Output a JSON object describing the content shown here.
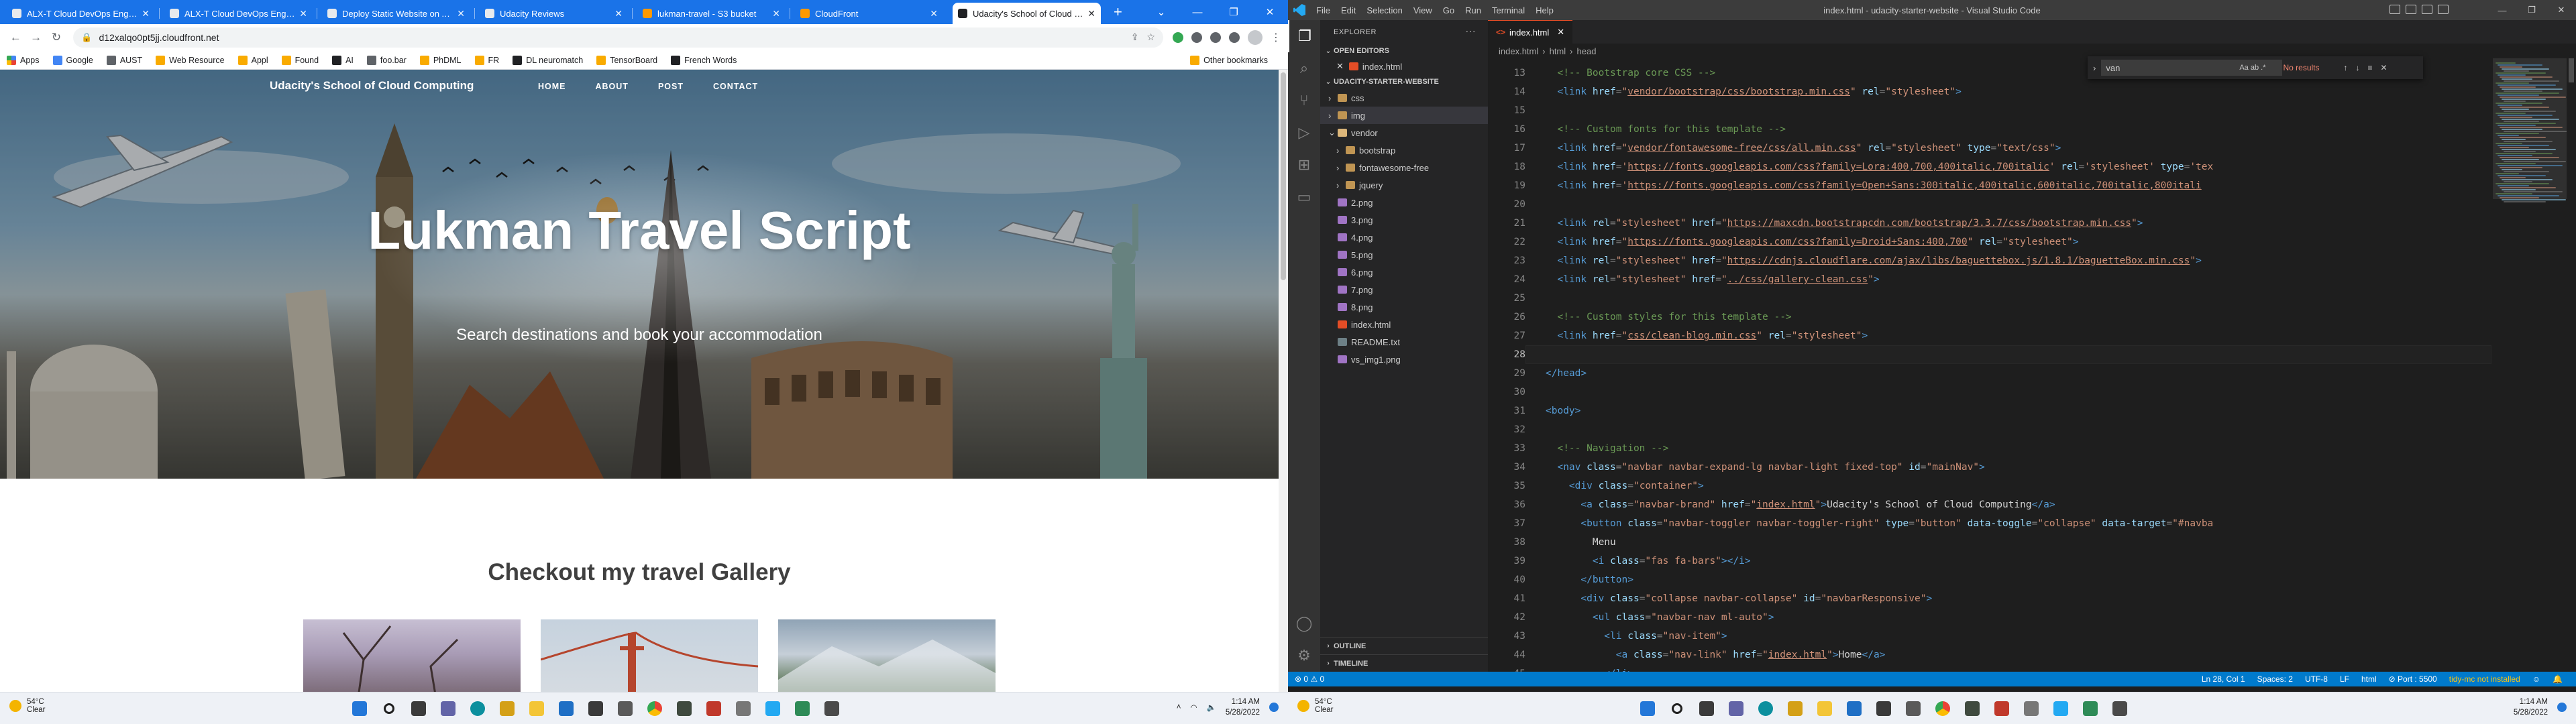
{
  "left": {
    "tabs": [
      {
        "title": "ALX-T Cloud DevOps Engineer",
        "color": "#e8eaed"
      },
      {
        "title": "ALX-T Cloud DevOps Engineer",
        "color": "#e8eaed"
      },
      {
        "title": "Deploy Static Website on AWS",
        "color": "#e8eaed"
      },
      {
        "title": "Udacity Reviews",
        "color": "#e8eaed"
      },
      {
        "title": "lukman-travel - S3 bucket",
        "color": "#ff9900"
      },
      {
        "title": "CloudFront",
        "color": "#ff9900"
      },
      {
        "title": "Udacity's School of Cloud Comp",
        "color": "#202124"
      }
    ],
    "address": "d12xalqo0pt5jj.cloudfront.net",
    "bookmarks": [
      "Apps",
      "Google",
      "AUST",
      "Web Resource",
      "Appl",
      "Found",
      "AI",
      "foo.bar",
      "PhDML",
      "FR",
      "DL neuromatch",
      "TensorBoard",
      "French Words"
    ],
    "other_bookmarks": "Other bookmarks",
    "site": {
      "brand": "Udacity's School of Cloud Computing",
      "nav": [
        "HOME",
        "ABOUT",
        "POST",
        "CONTACT"
      ],
      "hero_title": "Lukman Travel Script",
      "hero_subtitle": "Search destinations and book your accommodation",
      "gallery_heading": "Checkout my travel Gallery"
    },
    "taskbar": {
      "temp": "54°C",
      "weather": "Clear",
      "time": "1:14 AM",
      "date": "5/28/2022"
    }
  },
  "right": {
    "menu": [
      "File",
      "Edit",
      "Selection",
      "View",
      "Go",
      "Run",
      "Terminal",
      "Help"
    ],
    "window_title": "index.html - udacity-starter-website - Visual Studio Code",
    "explorer_title": "EXPLORER",
    "open_editors_label": "OPEN EDITORS",
    "open_editor_file": "index.html",
    "project_label": "UDACITY-STARTER-WEBSITE",
    "tree": [
      {
        "name": "css",
        "type": "folder",
        "depth": 1
      },
      {
        "name": "img",
        "type": "folder",
        "depth": 1,
        "selected": true
      },
      {
        "name": "vendor",
        "type": "folder-open",
        "depth": 1
      },
      {
        "name": "bootstrap",
        "type": "folder",
        "depth": 2
      },
      {
        "name": "fontawesome-free",
        "type": "folder",
        "depth": 2
      },
      {
        "name": "jquery",
        "type": "folder",
        "depth": 2
      },
      {
        "name": "2.png",
        "type": "img",
        "depth": 1
      },
      {
        "name": "3.png",
        "type": "img",
        "depth": 1
      },
      {
        "name": "4.png",
        "type": "img",
        "depth": 1
      },
      {
        "name": "5.png",
        "type": "img",
        "depth": 1
      },
      {
        "name": "6.png",
        "type": "img",
        "depth": 1
      },
      {
        "name": "7.png",
        "type": "img",
        "depth": 1
      },
      {
        "name": "8.png",
        "type": "img",
        "depth": 1
      },
      {
        "name": "index.html",
        "type": "html",
        "depth": 1
      },
      {
        "name": "README.txt",
        "type": "txt",
        "depth": 1
      },
      {
        "name": "vs_img1.png",
        "type": "img",
        "depth": 1
      }
    ],
    "outline_label": "OUTLINE",
    "timeline_label": "TIMELINE",
    "editor_tab": "index.html",
    "breadcrumb": [
      "index.html",
      "html",
      "head"
    ],
    "find": {
      "query": "van",
      "result": "No results",
      "options": "Aa  ab  .*"
    },
    "code": [
      {
        "n": 13,
        "parts": [
          [
            "com",
            "  <!-- Bootstrap core CSS -->"
          ]
        ]
      },
      {
        "n": 14,
        "parts": [
          [
            "tag",
            "  <link "
          ],
          [
            "att",
            "href"
          ],
          [
            "pun",
            "="
          ],
          [
            "str",
            "\""
          ],
          [
            "url",
            "vendor/bootstrap/css/bootstrap.min.css"
          ],
          [
            "str",
            "\""
          ],
          [
            "att",
            " rel"
          ],
          [
            "pun",
            "="
          ],
          [
            "str",
            "\"stylesheet\""
          ],
          [
            "tag",
            ">"
          ]
        ]
      },
      {
        "n": 15,
        "parts": []
      },
      {
        "n": 16,
        "parts": [
          [
            "com",
            "  <!-- Custom fonts for this template -->"
          ]
        ]
      },
      {
        "n": 17,
        "parts": [
          [
            "tag",
            "  <link "
          ],
          [
            "att",
            "href"
          ],
          [
            "pun",
            "="
          ],
          [
            "str",
            "\""
          ],
          [
            "url",
            "vendor/fontawesome-free/css/all.min.css"
          ],
          [
            "str",
            "\""
          ],
          [
            "att",
            " rel"
          ],
          [
            "pun",
            "="
          ],
          [
            "str",
            "\"stylesheet\""
          ],
          [
            "att",
            " type"
          ],
          [
            "pun",
            "="
          ],
          [
            "str",
            "\"text/css\""
          ],
          [
            "tag",
            ">"
          ]
        ]
      },
      {
        "n": 18,
        "parts": [
          [
            "tag",
            "  <link "
          ],
          [
            "att",
            "href"
          ],
          [
            "pun",
            "="
          ],
          [
            "str",
            "'"
          ],
          [
            "url",
            "https://fonts.googleapis.com/css?family=Lora:400,700,400italic,700italic"
          ],
          [
            "str",
            "'"
          ],
          [
            "att",
            " rel"
          ],
          [
            "pun",
            "="
          ],
          [
            "str",
            "'stylesheet'"
          ],
          [
            "att",
            " type"
          ],
          [
            "pun",
            "="
          ],
          [
            "str",
            "'tex"
          ]
        ]
      },
      {
        "n": 19,
        "parts": [
          [
            "tag",
            "  <link "
          ],
          [
            "att",
            "href"
          ],
          [
            "pun",
            "="
          ],
          [
            "str",
            "'"
          ],
          [
            "url",
            "https://fonts.googleapis.com/css?family=Open+Sans:300italic,400italic,600italic,700italic,800itali"
          ]
        ]
      },
      {
        "n": 20,
        "parts": []
      },
      {
        "n": 21,
        "parts": [
          [
            "tag",
            "  <link "
          ],
          [
            "att",
            "rel"
          ],
          [
            "pun",
            "="
          ],
          [
            "str",
            "\"stylesheet\""
          ],
          [
            "att",
            " href"
          ],
          [
            "pun",
            "="
          ],
          [
            "str",
            "\""
          ],
          [
            "url",
            "https://maxcdn.bootstrapcdn.com/bootstrap/3.3.7/css/bootstrap.min.css"
          ],
          [
            "str",
            "\""
          ],
          [
            "tag",
            ">"
          ]
        ]
      },
      {
        "n": 22,
        "parts": [
          [
            "tag",
            "  <link "
          ],
          [
            "att",
            "href"
          ],
          [
            "pun",
            "="
          ],
          [
            "str",
            "\""
          ],
          [
            "url",
            "https://fonts.googleapis.com/css?family=Droid+Sans:400,700"
          ],
          [
            "str",
            "\""
          ],
          [
            "att",
            " rel"
          ],
          [
            "pun",
            "="
          ],
          [
            "str",
            "\"stylesheet\""
          ],
          [
            "tag",
            ">"
          ]
        ]
      },
      {
        "n": 23,
        "parts": [
          [
            "tag",
            "  <link "
          ],
          [
            "att",
            "rel"
          ],
          [
            "pun",
            "="
          ],
          [
            "str",
            "\"stylesheet\""
          ],
          [
            "att",
            " href"
          ],
          [
            "pun",
            "="
          ],
          [
            "str",
            "\""
          ],
          [
            "url",
            "https://cdnjs.cloudflare.com/ajax/libs/baguettebox.js/1.8.1/baguetteBox.min.css"
          ],
          [
            "str",
            "\""
          ],
          [
            "tag",
            ">"
          ]
        ]
      },
      {
        "n": 24,
        "parts": [
          [
            "tag",
            "  <link "
          ],
          [
            "att",
            "rel"
          ],
          [
            "pun",
            "="
          ],
          [
            "str",
            "\"stylesheet\""
          ],
          [
            "att",
            " href"
          ],
          [
            "pun",
            "="
          ],
          [
            "str",
            "\""
          ],
          [
            "url",
            "../css/gallery-clean.css"
          ],
          [
            "str",
            "\""
          ],
          [
            "tag",
            ">"
          ]
        ]
      },
      {
        "n": 25,
        "parts": []
      },
      {
        "n": 26,
        "parts": [
          [
            "com",
            "  <!-- Custom styles for this template -->"
          ]
        ]
      },
      {
        "n": 27,
        "parts": [
          [
            "tag",
            "  <link "
          ],
          [
            "att",
            "href"
          ],
          [
            "pun",
            "="
          ],
          [
            "str",
            "\""
          ],
          [
            "url",
            "css/clean-blog.min.css"
          ],
          [
            "str",
            "\""
          ],
          [
            "att",
            " rel"
          ],
          [
            "pun",
            "="
          ],
          [
            "str",
            "\"stylesheet\""
          ],
          [
            "tag",
            ">"
          ]
        ]
      },
      {
        "n": 28,
        "parts": [],
        "current": true
      },
      {
        "n": 29,
        "parts": [
          [
            "tag",
            "</head>"
          ]
        ]
      },
      {
        "n": 30,
        "parts": []
      },
      {
        "n": 31,
        "parts": [
          [
            "tag",
            "<body>"
          ]
        ]
      },
      {
        "n": 32,
        "parts": []
      },
      {
        "n": 33,
        "parts": [
          [
            "com",
            "  <!-- Navigation -->"
          ]
        ]
      },
      {
        "n": 34,
        "parts": [
          [
            "tag",
            "  <nav "
          ],
          [
            "att",
            "class"
          ],
          [
            "pun",
            "="
          ],
          [
            "str",
            "\"navbar navbar-expand-lg navbar-light fixed-top\""
          ],
          [
            "att",
            " id"
          ],
          [
            "pun",
            "="
          ],
          [
            "str",
            "\"mainNav\""
          ],
          [
            "tag",
            ">"
          ]
        ]
      },
      {
        "n": 35,
        "parts": [
          [
            "tag",
            "    <div "
          ],
          [
            "att",
            "class"
          ],
          [
            "pun",
            "="
          ],
          [
            "str",
            "\"container\""
          ],
          [
            "tag",
            ">"
          ]
        ]
      },
      {
        "n": 36,
        "parts": [
          [
            "tag",
            "      <a "
          ],
          [
            "att",
            "class"
          ],
          [
            "pun",
            "="
          ],
          [
            "str",
            "\"navbar-brand\""
          ],
          [
            "att",
            " href"
          ],
          [
            "pun",
            "="
          ],
          [
            "str",
            "\""
          ],
          [
            "url",
            "index.html"
          ],
          [
            "str",
            "\""
          ],
          [
            "tag",
            ">"
          ],
          [
            "txt",
            "Udacity's School of Cloud Computing"
          ],
          [
            "tag",
            "</a>"
          ]
        ]
      },
      {
        "n": 37,
        "parts": [
          [
            "tag",
            "      <button "
          ],
          [
            "att",
            "class"
          ],
          [
            "pun",
            "="
          ],
          [
            "str",
            "\"navbar-toggler navbar-toggler-right\""
          ],
          [
            "att",
            " type"
          ],
          [
            "pun",
            "="
          ],
          [
            "str",
            "\"button\""
          ],
          [
            "att",
            " data-toggle"
          ],
          [
            "pun",
            "="
          ],
          [
            "str",
            "\"collapse\""
          ],
          [
            "att",
            " data-target"
          ],
          [
            "pun",
            "="
          ],
          [
            "str",
            "\"#navba"
          ]
        ]
      },
      {
        "n": 38,
        "parts": [
          [
            "txt",
            "        Menu"
          ]
        ]
      },
      {
        "n": 39,
        "parts": [
          [
            "tag",
            "        <i "
          ],
          [
            "att",
            "class"
          ],
          [
            "pun",
            "="
          ],
          [
            "str",
            "\"fas fa-bars\""
          ],
          [
            "tag",
            "></i>"
          ]
        ]
      },
      {
        "n": 40,
        "parts": [
          [
            "tag",
            "      </button>"
          ]
        ]
      },
      {
        "n": 41,
        "parts": [
          [
            "tag",
            "      <div "
          ],
          [
            "att",
            "class"
          ],
          [
            "pun",
            "="
          ],
          [
            "str",
            "\"collapse navbar-collapse\""
          ],
          [
            "att",
            " id"
          ],
          [
            "pun",
            "="
          ],
          [
            "str",
            "\"navbarResponsive\""
          ],
          [
            "tag",
            ">"
          ]
        ]
      },
      {
        "n": 42,
        "parts": [
          [
            "tag",
            "        <ul "
          ],
          [
            "att",
            "class"
          ],
          [
            "pun",
            "="
          ],
          [
            "str",
            "\"navbar-nav ml-auto\""
          ],
          [
            "tag",
            ">"
          ]
        ]
      },
      {
        "n": 43,
        "parts": [
          [
            "tag",
            "          <li "
          ],
          [
            "att",
            "class"
          ],
          [
            "pun",
            "="
          ],
          [
            "str",
            "\"nav-item\""
          ],
          [
            "tag",
            ">"
          ]
        ]
      },
      {
        "n": 44,
        "parts": [
          [
            "tag",
            "            <a "
          ],
          [
            "att",
            "class"
          ],
          [
            "pun",
            "="
          ],
          [
            "str",
            "\"nav-link\""
          ],
          [
            "att",
            " href"
          ],
          [
            "pun",
            "="
          ],
          [
            "str",
            "\""
          ],
          [
            "url",
            "index.html"
          ],
          [
            "str",
            "\""
          ],
          [
            "tag",
            ">"
          ],
          [
            "txt",
            "Home"
          ],
          [
            "tag",
            "</a>"
          ]
        ]
      },
      {
        "n": 45,
        "parts": [
          [
            "tag",
            "          </li>"
          ]
        ]
      }
    ],
    "status": {
      "errors": "⊗ 0 ⚠ 0",
      "position": "Ln 28, Col 1",
      "spaces": "Spaces: 2",
      "encoding": "UTF-8",
      "eol": "LF",
      "language": "html",
      "port": "⊘ Port : 5500",
      "tidy": "tidy-mc not installed"
    },
    "taskbar": {
      "temp": "54°C",
      "weather": "Clear",
      "time": "1:14 AM",
      "date": "5/28/2022"
    }
  }
}
